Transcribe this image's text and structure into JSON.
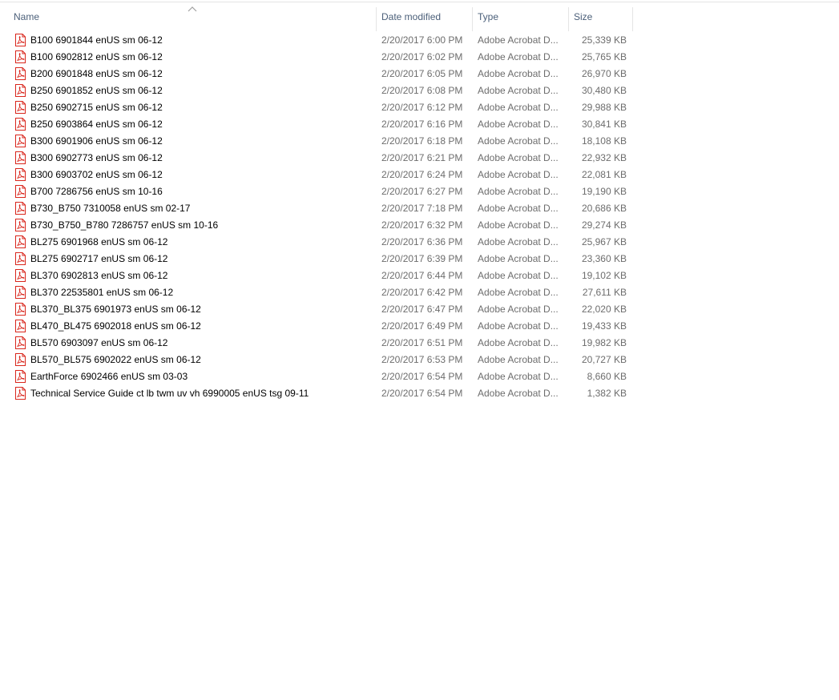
{
  "columns": {
    "name": "Name",
    "date": "Date modified",
    "type": "Type",
    "size": "Size",
    "sorted_by": "Name",
    "sort_direction": "ascending"
  },
  "colors": {
    "header_text": "#4c607a",
    "secondary_text": "#6d6d6d",
    "pdf_icon": "#d9261c"
  },
  "files": [
    {
      "name": "B100 6901844 enUS sm 06-12",
      "date": "2/20/2017 6:00 PM",
      "type": "Adobe Acrobat D...",
      "size": "25,339 KB",
      "icon": "pdf-file-icon"
    },
    {
      "name": "B100 6902812 enUS sm 06-12",
      "date": "2/20/2017 6:02 PM",
      "type": "Adobe Acrobat D...",
      "size": "25,765 KB",
      "icon": "pdf-file-icon"
    },
    {
      "name": "B200 6901848 enUS sm 06-12",
      "date": "2/20/2017 6:05 PM",
      "type": "Adobe Acrobat D...",
      "size": "26,970 KB",
      "icon": "pdf-file-icon"
    },
    {
      "name": "B250 6901852 enUS sm 06-12",
      "date": "2/20/2017 6:08 PM",
      "type": "Adobe Acrobat D...",
      "size": "30,480 KB",
      "icon": "pdf-file-icon"
    },
    {
      "name": "B250 6902715 enUS sm 06-12",
      "date": "2/20/2017 6:12 PM",
      "type": "Adobe Acrobat D...",
      "size": "29,988 KB",
      "icon": "pdf-file-icon"
    },
    {
      "name": "B250 6903864 enUS sm 06-12",
      "date": "2/20/2017 6:16 PM",
      "type": "Adobe Acrobat D...",
      "size": "30,841 KB",
      "icon": "pdf-file-icon"
    },
    {
      "name": "B300 6901906 enUS sm 06-12",
      "date": "2/20/2017 6:18 PM",
      "type": "Adobe Acrobat D...",
      "size": "18,108 KB",
      "icon": "pdf-file-icon"
    },
    {
      "name": "B300 6902773 enUS sm 06-12",
      "date": "2/20/2017 6:21 PM",
      "type": "Adobe Acrobat D...",
      "size": "22,932 KB",
      "icon": "pdf-file-icon"
    },
    {
      "name": "B300 6903702 enUS sm 06-12",
      "date": "2/20/2017 6:24 PM",
      "type": "Adobe Acrobat D...",
      "size": "22,081 KB",
      "icon": "pdf-file-icon"
    },
    {
      "name": "B700 7286756 enUS sm 10-16",
      "date": "2/20/2017 6:27 PM",
      "type": "Adobe Acrobat D...",
      "size": "19,190 KB",
      "icon": "pdf-file-icon"
    },
    {
      "name": "B730_B750 7310058 enUS sm 02-17",
      "date": "2/20/2017 7:18 PM",
      "type": "Adobe Acrobat D...",
      "size": "20,686 KB",
      "icon": "pdf-file-icon"
    },
    {
      "name": "B730_B750_B780 7286757 enUS sm 10-16",
      "date": "2/20/2017 6:32 PM",
      "type": "Adobe Acrobat D...",
      "size": "29,274 KB",
      "icon": "pdf-file-icon"
    },
    {
      "name": "BL275 6901968 enUS sm 06-12",
      "date": "2/20/2017 6:36 PM",
      "type": "Adobe Acrobat D...",
      "size": "25,967 KB",
      "icon": "pdf-file-icon"
    },
    {
      "name": "BL275 6902717 enUS sm 06-12",
      "date": "2/20/2017 6:39 PM",
      "type": "Adobe Acrobat D...",
      "size": "23,360 KB",
      "icon": "pdf-file-icon"
    },
    {
      "name": "BL370 6902813 enUS sm 06-12",
      "date": "2/20/2017 6:44 PM",
      "type": "Adobe Acrobat D...",
      "size": "19,102 KB",
      "icon": "pdf-file-icon"
    },
    {
      "name": "BL370 22535801 enUS sm 06-12",
      "date": "2/20/2017 6:42 PM",
      "type": "Adobe Acrobat D...",
      "size": "27,611 KB",
      "icon": "pdf-file-icon"
    },
    {
      "name": "BL370_BL375 6901973 enUS sm 06-12",
      "date": "2/20/2017 6:47 PM",
      "type": "Adobe Acrobat D...",
      "size": "22,020 KB",
      "icon": "pdf-file-icon"
    },
    {
      "name": "BL470_BL475 6902018 enUS sm 06-12",
      "date": "2/20/2017 6:49 PM",
      "type": "Adobe Acrobat D...",
      "size": "19,433 KB",
      "icon": "pdf-file-icon"
    },
    {
      "name": "BL570 6903097 enUS sm 06-12",
      "date": "2/20/2017 6:51 PM",
      "type": "Adobe Acrobat D...",
      "size": "19,982 KB",
      "icon": "pdf-file-icon"
    },
    {
      "name": "BL570_BL575 6902022 enUS sm 06-12",
      "date": "2/20/2017 6:53 PM",
      "type": "Adobe Acrobat D...",
      "size": "20,727 KB",
      "icon": "pdf-file-icon"
    },
    {
      "name": "EarthForce 6902466 enUS sm 03-03",
      "date": "2/20/2017 6:54 PM",
      "type": "Adobe Acrobat D...",
      "size": "8,660 KB",
      "icon": "pdf-file-icon"
    },
    {
      "name": "Technical Service Guide ct lb twm uv vh 6990005 enUS tsg 09-11",
      "date": "2/20/2017 6:54 PM",
      "type": "Adobe Acrobat D...",
      "size": "1,382 KB",
      "icon": "pdf-file-icon"
    }
  ]
}
